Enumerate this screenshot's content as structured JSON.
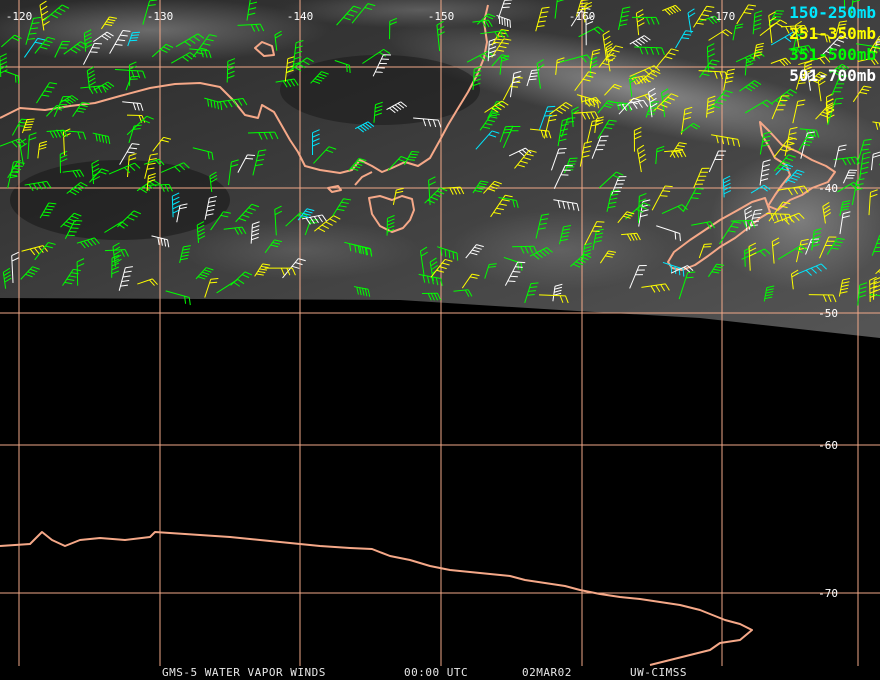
{
  "colors": {
    "grid": "#f0a888",
    "coast": "#f5a888",
    "label": "#ffffff",
    "background": "#000000"
  },
  "legend": [
    {
      "label": "150-250mb",
      "color": "#00e8ff"
    },
    {
      "label": "251-350mb",
      "color": "#ffff00"
    },
    {
      "label": "351-500mb",
      "color": "#00ff00"
    },
    {
      "label": "501-700mb",
      "color": "#ffffff"
    }
  ],
  "longitude_labels": [
    "-120",
    "-130",
    "-140",
    "-150",
    "-160",
    "-170"
  ],
  "latitude_labels": [
    "-40",
    "-50",
    "-60",
    "-70"
  ],
  "footer": {
    "product": "GMS-5 WATER VAPOR WINDS",
    "time": "00:00 UTC",
    "date": "02MAR02",
    "source": "UW-CIMSS"
  }
}
